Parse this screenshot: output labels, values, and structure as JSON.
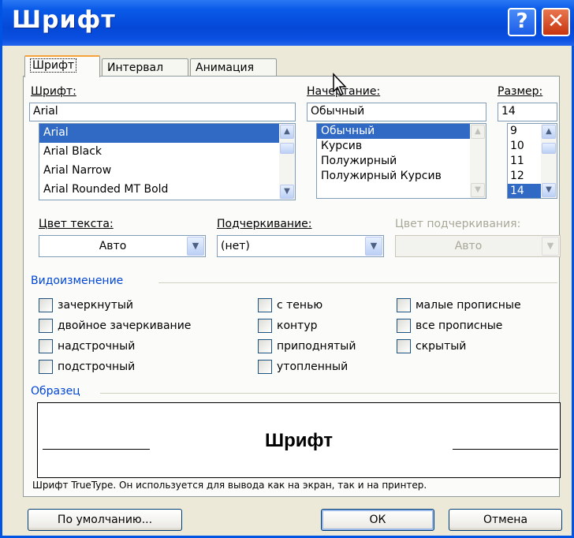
{
  "window": {
    "title": "Шрифт",
    "help": "?",
    "close": "✕"
  },
  "tabs": [
    {
      "label": "Шрифт",
      "active": true
    },
    {
      "label": "Интервал",
      "active": false
    },
    {
      "label": "Анимация",
      "active": false
    }
  ],
  "font": {
    "label": "Шрифт:",
    "value": "Arial",
    "items": [
      "Arial",
      "Arial Black",
      "Arial Narrow",
      "Arial Rounded MT Bold"
    ],
    "selected": "Arial"
  },
  "style": {
    "label": "Начертание:",
    "value": "Обычный",
    "items": [
      "Обычный",
      "Курсив",
      "Полужирный",
      "Полужирный Курсив"
    ],
    "selected": "Обычный"
  },
  "size": {
    "label": "Размер:",
    "value": "14",
    "items": [
      "9",
      "10",
      "11",
      "12",
      "14"
    ],
    "selected": "14"
  },
  "color": {
    "label": "Цвет текста:",
    "value": "Авто"
  },
  "underline": {
    "label": "Подчеркивание:",
    "value": "(нет)"
  },
  "underline_color": {
    "label": "Цвет подчеркивания:",
    "value": "Авто",
    "disabled": true
  },
  "effects": {
    "label": "Видоизменение",
    "col1": [
      "зачеркнутый",
      "двойное зачеркивание",
      "надстрочный",
      "подстрочный"
    ],
    "col2": [
      "с тенью",
      "контур",
      "приподнятый",
      "утопленный"
    ],
    "col3": [
      "малые прописные",
      "все прописные",
      "скрытый"
    ]
  },
  "preview": {
    "label": "Образец",
    "text": "Шрифт",
    "note": "Шрифт TrueType. Он используется для вывода как на экран, так и на принтер."
  },
  "buttons": {
    "default": "По умолчанию...",
    "ok": "ОК",
    "cancel": "Отмена"
  },
  "colors": {
    "title_bar": "#0a5be8",
    "dialog_bg": "#ece9d8",
    "selection": "#316ac5",
    "group_label": "#0046d5"
  }
}
